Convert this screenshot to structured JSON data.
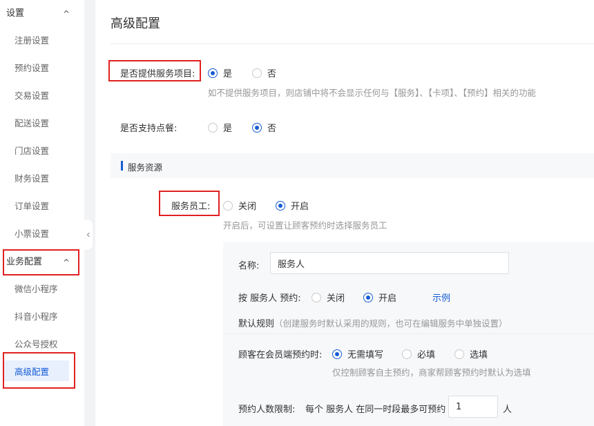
{
  "sidebar": {
    "group_settings": "设置",
    "settings_items": [
      {
        "label": "注册设置"
      },
      {
        "label": "预约设置"
      },
      {
        "label": "交易设置"
      },
      {
        "label": "配送设置"
      },
      {
        "label": "门店设置"
      },
      {
        "label": "财务设置"
      },
      {
        "label": "订单设置"
      },
      {
        "label": "小票设置"
      }
    ],
    "group_business": "业务配置",
    "business_items": [
      {
        "label": "微信小程序"
      },
      {
        "label": "抖音小程序"
      },
      {
        "label": "公众号授权"
      },
      {
        "label": "高级配置"
      }
    ]
  },
  "page": {
    "title": "高级配置",
    "service_items": {
      "label": "是否提供服务项目:",
      "opt_yes": "是",
      "opt_no": "否",
      "selected": "是",
      "help": "如不提供服务项目，则店铺中将不会显示任何与【服务】、【卡项】、【预约】相关的功能"
    },
    "ordering": {
      "label": "是否支持点餐:",
      "opt_yes": "是",
      "opt_no": "否",
      "selected": "否"
    },
    "section_title": "服务资源",
    "staff": {
      "label": "服务员工:",
      "opt_off": "关闭",
      "opt_on": "开启",
      "selected": "开启",
      "help": "开启后，可设置让顾客预约时选择服务员工"
    },
    "panel": {
      "name_label": "名称:",
      "name_value": "服务人",
      "by_label": "按 服务人 预约:",
      "by_off": "关闭",
      "by_on": "开启",
      "by_selected": "开启",
      "example_link": "示例",
      "default_rule_title": "默认规则",
      "default_rule_note": "（创建服务时默认采用的规则，也可在编辑服务中单独设置）",
      "customer_label": "顾客在会员端预约时:",
      "cust_opt1": "无需填写",
      "cust_opt2": "必填",
      "cust_opt3": "选填",
      "cust_selected": "无需填写",
      "customer_help": "仅控制顾客自主预约，商家帮顾客预约时默认为选填",
      "limit_label": "预约人数限制:",
      "limit_prefix": "每个 服务人 在同一时段最多可预约",
      "limit_value": "1",
      "limit_unit": "人"
    }
  },
  "colors": {
    "primary": "#155bd4",
    "highlight_box": "#e02020",
    "active_bg": "#e8f0fe"
  }
}
